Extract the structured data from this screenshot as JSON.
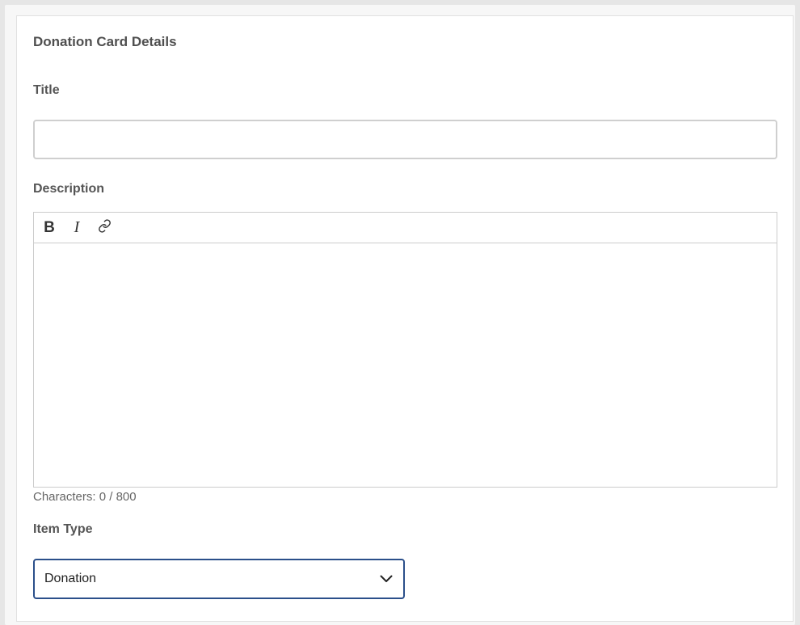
{
  "card": {
    "title": "Donation Card Details"
  },
  "fields": {
    "title_label": "Title",
    "title_value": "",
    "description_label": "Description",
    "description_value": "",
    "toolbar": {
      "bold_label": "B",
      "italic_label": "I",
      "link_icon": "link-icon"
    },
    "counter_prefix": "Characters:",
    "counter_current": "0",
    "counter_sep": "/",
    "counter_max": "800",
    "item_type_label": "Item Type",
    "item_type_value": "Donation",
    "item_type_icon": "chevron-down-icon"
  },
  "colors": {
    "select_border": "#2b4f8a",
    "text": "#4a4a4a"
  }
}
